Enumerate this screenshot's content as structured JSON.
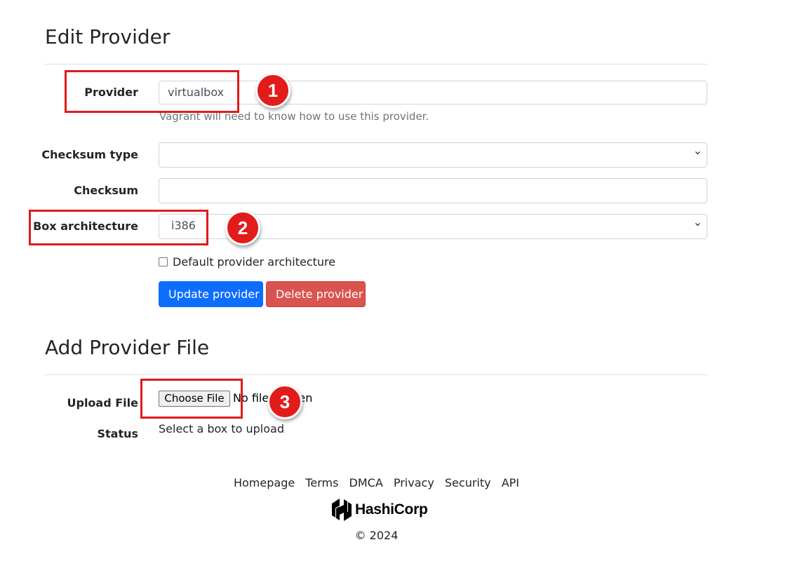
{
  "edit_section": {
    "title": "Edit Provider",
    "provider_label": "Provider",
    "provider_value": "virtualbox",
    "provider_help": "Vagrant will need to know how to use this provider.",
    "checksum_type_label": "Checksum type",
    "checksum_type_value": "",
    "checksum_label": "Checksum",
    "checksum_value": "",
    "box_architecture_label": "Box architecture",
    "box_architecture_value": "i386",
    "default_arch_label": "Default provider architecture",
    "default_arch_checked": false,
    "update_button": "Update provider",
    "delete_button": "Delete provider"
  },
  "add_file_section": {
    "title": "Add Provider File",
    "upload_label": "Upload File",
    "choose_file_button": "Choose File",
    "file_status": "No file chosen",
    "status_label": "Status",
    "status_value": "Select a box to upload"
  },
  "annotations": [
    "1",
    "2",
    "3"
  ],
  "footer": {
    "links": [
      "Homepage",
      "Terms",
      "DMCA",
      "Privacy",
      "Security",
      "API"
    ],
    "brand": "HashiCorp",
    "copyright": "© 2024"
  },
  "colors": {
    "primary": "#0d6efd",
    "danger": "#d9534f",
    "annotation": "#e21b1b"
  }
}
